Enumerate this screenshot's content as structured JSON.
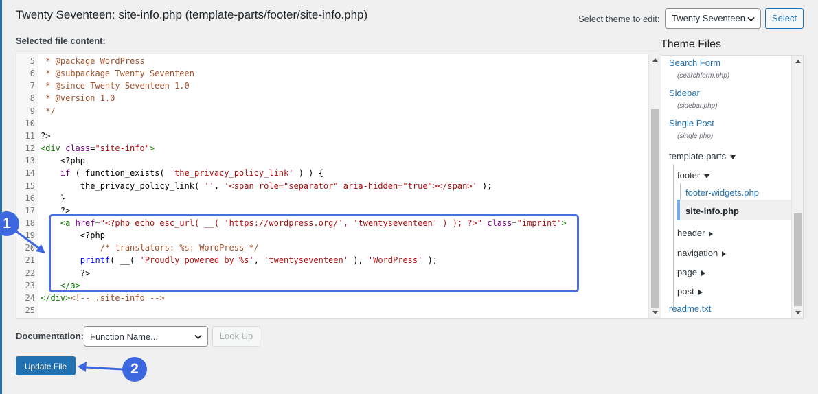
{
  "header": {
    "title": "Twenty Seventeen: site-info.php (template-parts/footer/site-info.php)",
    "selected_label": "Selected file content:",
    "theme_select_label": "Select theme to edit:",
    "theme_select_value": "Twenty Seventeen",
    "select_button": "Select"
  },
  "editor": {
    "lines": [
      {
        "n": "5",
        "parts": [
          {
            "t": " * @package WordPress",
            "c": "c-com"
          }
        ]
      },
      {
        "n": "6",
        "parts": [
          {
            "t": " * @subpackage Twenty_Seventeen",
            "c": "c-com"
          }
        ]
      },
      {
        "n": "7",
        "parts": [
          {
            "t": " * @since Twenty Seventeen 1.0",
            "c": "c-com"
          }
        ]
      },
      {
        "n": "8",
        "parts": [
          {
            "t": " * @version 1.0",
            "c": "c-com"
          }
        ]
      },
      {
        "n": "9",
        "parts": [
          {
            "t": " */",
            "c": "c-com"
          }
        ]
      },
      {
        "n": "10",
        "parts": []
      },
      {
        "n": "11",
        "parts": [
          {
            "t": "?>",
            "c": "c-plain"
          }
        ]
      },
      {
        "n": "12",
        "parts": [
          {
            "t": "<div ",
            "c": "c-tag"
          },
          {
            "t": "class",
            "c": "c-kw"
          },
          {
            "t": "=",
            "c": "c-plain"
          },
          {
            "t": "\"site-info\"",
            "c": "c-str"
          },
          {
            "t": ">",
            "c": "c-tag"
          }
        ]
      },
      {
        "n": "13",
        "parts": [
          {
            "t": "    <?php",
            "c": "c-plain"
          }
        ]
      },
      {
        "n": "14",
        "parts": [
          {
            "t": "    ",
            "c": "c-plain"
          },
          {
            "t": "if",
            "c": "c-kw"
          },
          {
            "t": " ( function_exists( ",
            "c": "c-plain"
          },
          {
            "t": "'the_privacy_policy_link'",
            "c": "c-str"
          },
          {
            "t": " ) ) {",
            "c": "c-plain"
          }
        ]
      },
      {
        "n": "15",
        "parts": [
          {
            "t": "        the_privacy_policy_link( ",
            "c": "c-plain"
          },
          {
            "t": "''",
            "c": "c-str"
          },
          {
            "t": ", ",
            "c": "c-plain"
          },
          {
            "t": "'<span role=\"separator\" aria-hidden=\"true\"></span>'",
            "c": "c-str"
          },
          {
            "t": " );",
            "c": "c-plain"
          }
        ]
      },
      {
        "n": "16",
        "parts": [
          {
            "t": "    }",
            "c": "c-plain"
          }
        ]
      },
      {
        "n": "17",
        "parts": [
          {
            "t": "    ?>",
            "c": "c-plain"
          }
        ]
      },
      {
        "n": "18",
        "parts": [
          {
            "t": "    <a ",
            "c": "c-tag"
          },
          {
            "t": "href",
            "c": "c-kw"
          },
          {
            "t": "=",
            "c": "c-plain"
          },
          {
            "t": "\"<?php echo esc_url( __( ",
            "c": "c-str"
          },
          {
            "t": "'https://wordpress.org/'",
            "c": "c-str"
          },
          {
            "t": ", ",
            "c": "c-str"
          },
          {
            "t": "'twentyseventeen'",
            "c": "c-str"
          },
          {
            "t": " ) ); ?>\"",
            "c": "c-str"
          },
          {
            "t": " class",
            "c": "c-kw"
          },
          {
            "t": "=",
            "c": "c-plain"
          },
          {
            "t": "\"imprint\"",
            "c": "c-str"
          },
          {
            "t": ">",
            "c": "c-tag"
          }
        ]
      },
      {
        "n": "19",
        "parts": [
          {
            "t": "        <?php",
            "c": "c-plain"
          }
        ]
      },
      {
        "n": "20",
        "parts": [
          {
            "t": "            /* translators: %s: WordPress */",
            "c": "c-com"
          }
        ]
      },
      {
        "n": "21",
        "parts": [
          {
            "t": "        ",
            "c": "c-plain"
          },
          {
            "t": "printf",
            "c": "c-def"
          },
          {
            "t": "( __( ",
            "c": "c-plain"
          },
          {
            "t": "'Proudly powered by %s'",
            "c": "c-str"
          },
          {
            "t": ", ",
            "c": "c-plain"
          },
          {
            "t": "'twentyseventeen'",
            "c": "c-str"
          },
          {
            "t": " ), ",
            "c": "c-plain"
          },
          {
            "t": "'WordPress'",
            "c": "c-str"
          },
          {
            "t": " );",
            "c": "c-plain"
          }
        ]
      },
      {
        "n": "22",
        "parts": [
          {
            "t": "        ?>",
            "c": "c-plain"
          }
        ]
      },
      {
        "n": "23",
        "parts": [
          {
            "t": "    </a>",
            "c": "c-tag"
          }
        ]
      },
      {
        "n": "24",
        "parts": [
          {
            "t": "</div>",
            "c": "c-tag"
          },
          {
            "t": "<!-- .site-info -->",
            "c": "c-com"
          }
        ]
      },
      {
        "n": "25",
        "parts": []
      }
    ]
  },
  "files": {
    "heading": "Theme Files",
    "search_form": "Search Form",
    "search_form_file": "(searchform.php)",
    "sidebar": "Sidebar",
    "sidebar_file": "(sidebar.php)",
    "single_post": "Single Post",
    "single_post_file": "(single.php)",
    "template_parts": "template-parts",
    "footer": "footer",
    "footer_widgets": "footer-widgets.php",
    "site_info": "site-info.php",
    "header": "header",
    "navigation": "navigation",
    "page": "page",
    "post": "post",
    "readme": "readme.txt"
  },
  "bottom": {
    "documentation_label": "Documentation:",
    "function_select_value": "Function Name...",
    "lookup_button": "Look Up",
    "update_button": "Update File"
  },
  "annotations": {
    "callout_1": "1",
    "callout_2": "2"
  },
  "colors": {
    "accent": "#2271b1",
    "annotation": "#3d67de"
  }
}
